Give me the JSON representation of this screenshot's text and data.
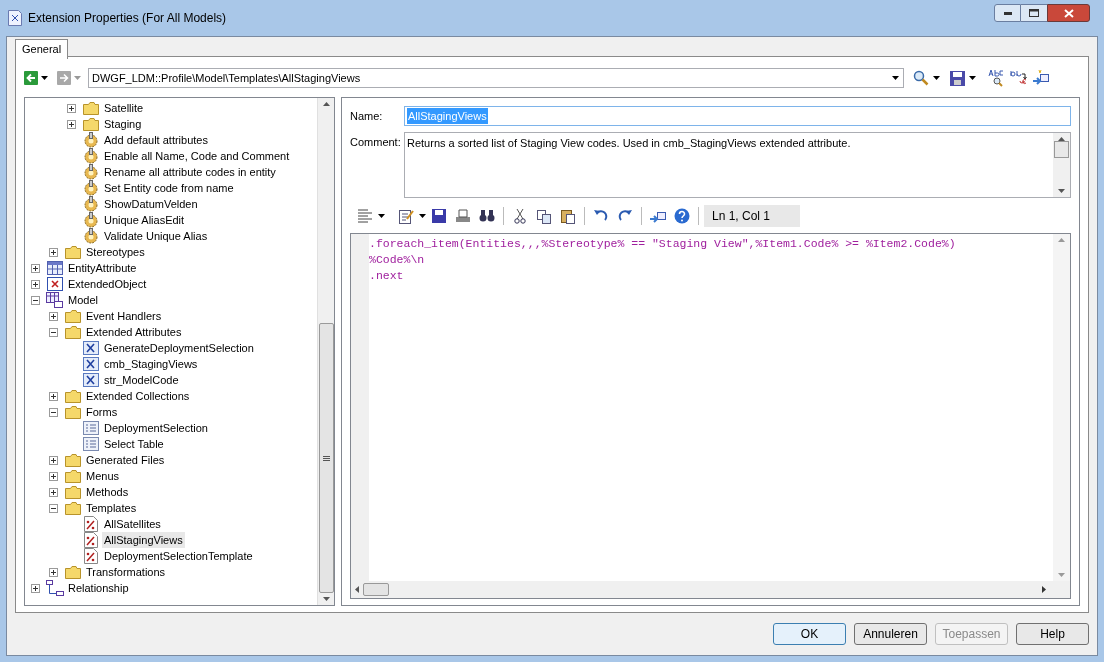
{
  "window": {
    "title": "Extension Properties (For All Models)"
  },
  "tabs": [
    {
      "label": "General",
      "selected": true
    }
  ],
  "path": {
    "value": "DWGF_LDM::Profile\\Model\\Templates\\AllStagingViews"
  },
  "tree": [
    {
      "children": [
        {
          "children": [
            {
              "label": "Satellite",
              "kind": "folder",
              "expanded": false,
              "selected": false
            },
            {
              "label": "Staging",
              "kind": "folder",
              "expanded": false,
              "selected": false
            },
            {
              "label": "Add default attributes",
              "kind": "gear",
              "selected": false
            },
            {
              "label": "Enable all Name, Code and Comment",
              "kind": "gear",
              "selected": false
            },
            {
              "label": "Rename all attribute codes in entity",
              "kind": "gear",
              "selected": false
            },
            {
              "label": "Set Entity code from name",
              "kind": "gear",
              "selected": false
            },
            {
              "label": "ShowDatumVelden",
              "kind": "gear",
              "selected": false
            },
            {
              "label": "Unique AliasEdit",
              "kind": "gear",
              "selected": false
            },
            {
              "label": "Validate Unique Alias",
              "kind": "gear",
              "selected": false
            }
          ]
        },
        {
          "label": "Stereotypes",
          "kind": "folder",
          "expanded": false,
          "selected": false
        }
      ]
    },
    {
      "label": "EntityAttribute",
      "kind": "grid",
      "expanded": false,
      "selected": false
    },
    {
      "label": "ExtendedObject",
      "kind": "xbox",
      "expanded": false,
      "selected": false
    },
    {
      "label": "Model",
      "kind": "model",
      "expanded": true,
      "selected": false,
      "children": [
        {
          "label": "Event Handlers",
          "kind": "folder",
          "expanded": false,
          "selected": false
        },
        {
          "label": "Extended Attributes",
          "kind": "folder",
          "expanded": true,
          "selected": false,
          "children": [
            {
              "label": "GenerateDeploymentSelection",
              "kind": "attr",
              "selected": false
            },
            {
              "label": "cmb_StagingViews",
              "kind": "attr",
              "selected": false
            },
            {
              "label": "str_ModelCode",
              "kind": "attr",
              "selected": false
            }
          ]
        },
        {
          "label": "Extended Collections",
          "kind": "folder",
          "expanded": false,
          "selected": false
        },
        {
          "label": "Forms",
          "kind": "folder",
          "expanded": true,
          "selected": false,
          "children": [
            {
              "label": "DeploymentSelection",
              "kind": "form",
              "selected": false
            },
            {
              "label": "Select Table",
              "kind": "form",
              "selected": false
            }
          ]
        },
        {
          "label": "Generated Files",
          "kind": "folder",
          "expanded": false,
          "selected": false
        },
        {
          "label": "Menus",
          "kind": "folder",
          "expanded": false,
          "selected": false
        },
        {
          "label": "Methods",
          "kind": "folder",
          "expanded": false,
          "selected": false
        },
        {
          "label": "Templates",
          "kind": "folder",
          "expanded": true,
          "selected": false,
          "children": [
            {
              "label": "AllSatellites",
              "kind": "template",
              "selected": false
            },
            {
              "label": "AllStagingViews",
              "kind": "template",
              "selected": true
            },
            {
              "label": "DeploymentSelectionTemplate",
              "kind": "template",
              "selected": false
            }
          ]
        },
        {
          "label": "Transformations",
          "kind": "folder",
          "expanded": false,
          "selected": false
        }
      ]
    },
    {
      "label": "Relationship",
      "kind": "relation",
      "expanded": false,
      "selected": false
    }
  ],
  "name": {
    "label": "Name:",
    "value": "AllStagingViews"
  },
  "comment": {
    "label": "Comment:",
    "value": "Returns a sorted list of Staging View codes. Used in cmb_StagingViews extended attribute."
  },
  "editor": {
    "status": "Ln 1, Col 1",
    "lines": [
      ".foreach_item(Entities,,,%Stereotype% == \"Staging View\",%Item1.Code% >= %Item2.Code%)",
      "%Code%\\n",
      ".next"
    ]
  },
  "buttons": [
    {
      "label": "OK",
      "disabled": false,
      "default": true
    },
    {
      "label": "Annuleren",
      "disabled": false,
      "default": false
    },
    {
      "label": "Toepassen",
      "disabled": true,
      "default": false
    },
    {
      "label": "Help",
      "disabled": false,
      "default": false
    }
  ]
}
